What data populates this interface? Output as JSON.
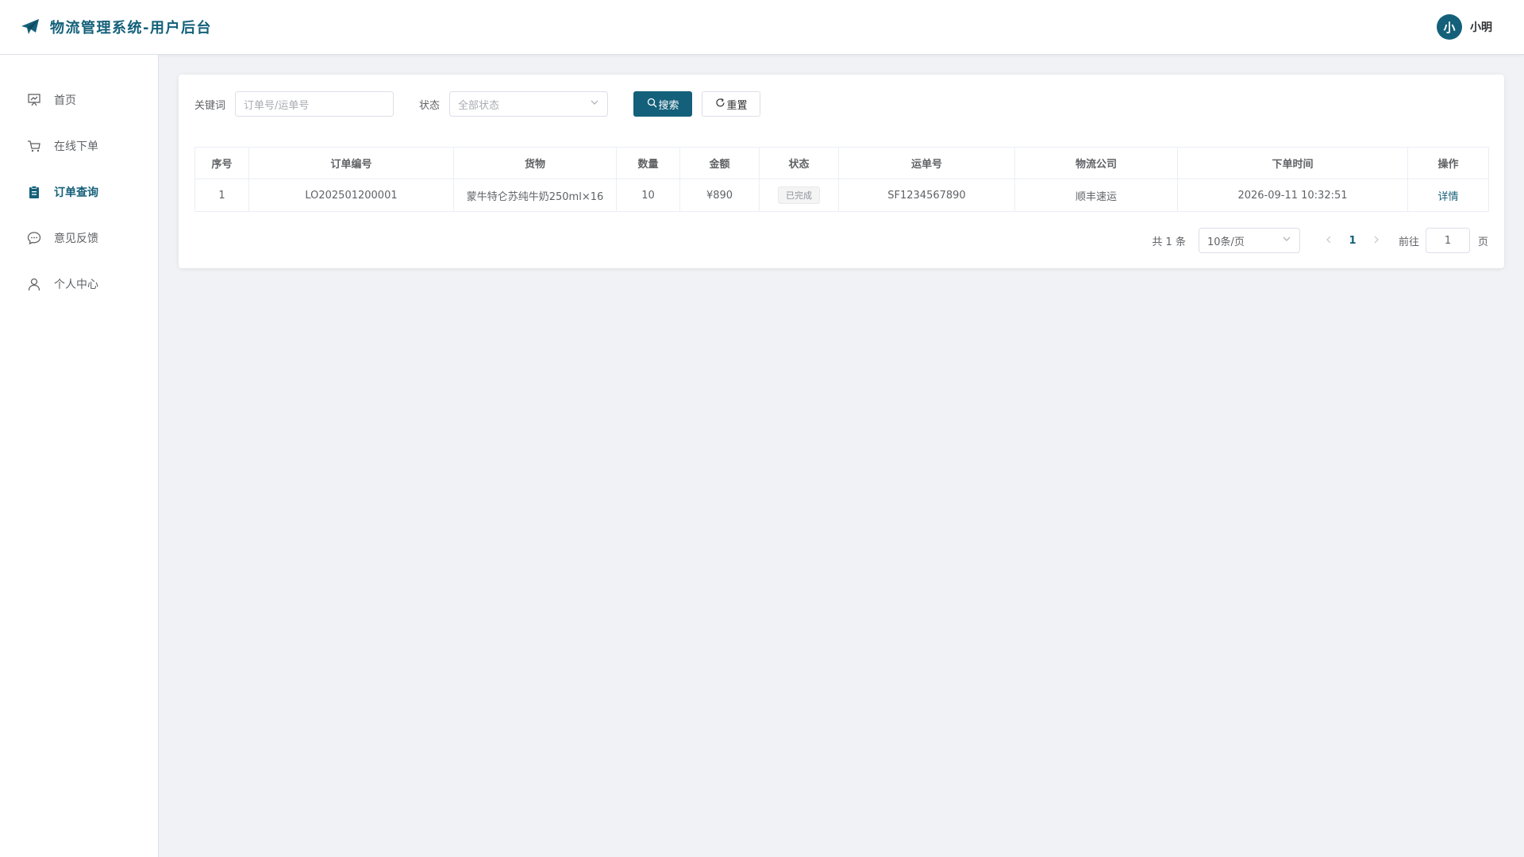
{
  "header": {
    "title": "物流管理系统-用户后台",
    "logo_icon": "paper-plane-icon",
    "user": {
      "avatar_text": "小",
      "name": "小明"
    }
  },
  "sidebar": {
    "items": [
      {
        "label": "首页",
        "icon": "dashboard-icon",
        "active": false
      },
      {
        "label": "在线下单",
        "icon": "cart-icon",
        "active": false
      },
      {
        "label": "订单查询",
        "icon": "clipboard-icon",
        "active": true
      },
      {
        "label": "意见反馈",
        "icon": "chat-icon",
        "active": false
      },
      {
        "label": "个人中心",
        "icon": "user-icon",
        "active": false
      }
    ]
  },
  "filters": {
    "keyword_label": "关键词",
    "keyword_placeholder": "订单号/运单号",
    "status_label": "状态",
    "status_value": "全部状态",
    "search_label": "搜索",
    "reset_label": "重置"
  },
  "table": {
    "columns": [
      "序号",
      "订单编号",
      "货物",
      "数量",
      "金额",
      "状态",
      "运单号",
      "物流公司",
      "下单时间",
      "操作"
    ],
    "rows": [
      {
        "index": "1",
        "order_no": "LO202501200001",
        "goods": "蒙牛特仑苏纯牛奶250ml×16",
        "quantity": "10",
        "amount": "¥890",
        "status": "已完成",
        "waybill": "SF1234567890",
        "company": "顺丰速运",
        "time": "2026-09-11 10:32:51",
        "action": "详情"
      }
    ]
  },
  "pagination": {
    "total_text": "共 1 条",
    "page_size": "10条/页",
    "current_page": "1",
    "goto_label": "前往",
    "goto_value": "1",
    "page_suffix": "页"
  },
  "colors": {
    "primary": "#14607a",
    "background": "#f0f2f5"
  }
}
